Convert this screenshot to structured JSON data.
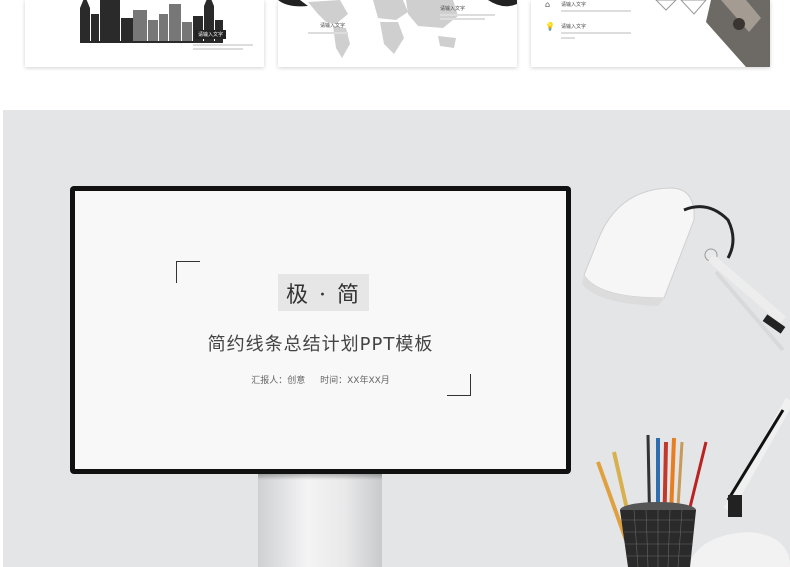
{
  "thumbnails": [
    {
      "label": "请输入文字"
    },
    {
      "label": "请输入文字",
      "label2": "请输入文字"
    },
    {
      "label": "请输入文字",
      "label2": "请输入文字"
    }
  ],
  "slide": {
    "title": "极 · 简",
    "subtitle": "简约线条总结计划PPT模板",
    "reporter": "汇报人：创意",
    "time": "时间：XX年XX月"
  },
  "colors": {
    "background": "#e4e5e7",
    "monitor_bezel": "#111111",
    "screen": "#f8f8f8",
    "title_box": "#e6e6e6"
  }
}
